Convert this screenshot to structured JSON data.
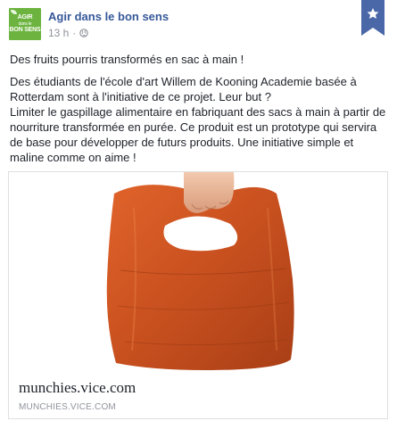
{
  "header": {
    "page_name": "Agir dans le bon sens",
    "time": "13 h",
    "separator": "·",
    "avatar_text": [
      "AGIR",
      "dans le",
      "BON SENS"
    ]
  },
  "post": {
    "line1": "Des fruits pourris transformés en sac à main !",
    "paragraph": "Des étudiants de l'école d'art Willem de Kooning Academie basée à Rotterdam sont à l'initiative de ce projet. Leur but ?\nLimiter le gaspillage alimentaire en fabriquant des sacs à main à partir de nourriture transformée en purée. Ce produit est un prototype qui servira de base pour développer de futurs produits. Une initiative simple et maline comme on aime !"
  },
  "link_card": {
    "title": "munchies.vice.com",
    "domain": "MUNCHIES.VICE.COM",
    "image_alt": "fruit leather handbag held by a hand"
  },
  "colors": {
    "brand_blue": "#365899",
    "avatar_green": "#6cb33f",
    "bookmark_blue": "#4a67a8"
  }
}
